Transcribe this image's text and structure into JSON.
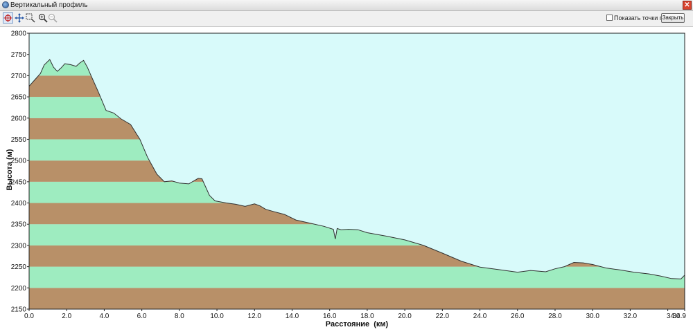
{
  "window": {
    "title": "Вертикальный профиль",
    "close_glyph": "✕"
  },
  "toolbar": {
    "tools": [
      "target-icon",
      "pan-icon",
      "zoom-rect-icon",
      "zoom-in-icon",
      "zoom-out-icon"
    ],
    "show_points_label": "Показать точки пути",
    "show_points_checked": false,
    "close_label": "Закрыть"
  },
  "chart_data": {
    "type": "area",
    "xlabel": "Расстояние  (км)",
    "ylabel": "Высота (м)",
    "xlim": [
      0,
      34.9
    ],
    "ylim": [
      2150,
      2800
    ],
    "x_ticks": [
      "0.0",
      "2.0",
      "4.0",
      "6.0",
      "8.0",
      "10.0",
      "12.0",
      "14.0",
      "16.0",
      "18.0",
      "20.0",
      "22.0",
      "24.0",
      "26.0",
      "28.0",
      "30.0",
      "32.0",
      "34.0",
      "34.9"
    ],
    "y_ticks": [
      "2800",
      "2750",
      "2700",
      "2650",
      "2600",
      "2550",
      "2500",
      "2450",
      "2400",
      "2350",
      "2300",
      "2250",
      "2200",
      "2150"
    ],
    "band_colors": [
      "#b89068",
      "#9eecc0"
    ],
    "background": "#d8fafa",
    "line_color": "#303030",
    "series": [
      {
        "x": [
          0.0,
          0.3,
          0.6,
          0.8,
          1.1,
          1.3,
          1.5,
          1.7,
          1.9,
          2.2,
          2.5,
          2.7,
          2.9,
          3.1,
          3.3,
          3.7,
          4.1,
          4.5,
          4.9,
          5.4,
          5.9,
          6.3,
          6.8,
          7.2,
          7.6,
          8.0,
          8.5,
          9.0,
          9.2,
          9.6,
          9.9,
          10.5,
          11.0,
          11.5,
          12.0,
          12.3,
          12.6,
          13.0,
          13.6,
          14.2,
          15.0,
          15.7,
          16.2,
          16.3,
          16.4,
          16.6,
          17.0,
          17.5,
          18.0,
          19.0,
          20.0,
          21.0,
          22.0,
          23.0,
          24.0,
          25.0,
          26.0,
          26.7,
          27.5,
          28.0,
          28.5,
          29.0,
          29.5,
          30.0,
          30.7,
          31.5,
          32.2,
          33.0,
          33.6,
          34.2,
          34.7,
          34.9
        ],
        "y": [
          2675,
          2690,
          2705,
          2725,
          2738,
          2720,
          2710,
          2718,
          2728,
          2726,
          2722,
          2730,
          2736,
          2720,
          2700,
          2660,
          2618,
          2612,
          2598,
          2585,
          2550,
          2508,
          2468,
          2450,
          2452,
          2447,
          2445,
          2458,
          2457,
          2418,
          2405,
          2400,
          2397,
          2392,
          2398,
          2393,
          2385,
          2380,
          2373,
          2360,
          2352,
          2345,
          2338,
          2315,
          2340,
          2337,
          2338,
          2337,
          2330,
          2322,
          2313,
          2300,
          2282,
          2263,
          2249,
          2243,
          2237,
          2241,
          2238,
          2245,
          2250,
          2260,
          2259,
          2255,
          2247,
          2242,
          2237,
          2233,
          2228,
          2222,
          2221,
          2230
        ]
      }
    ]
  }
}
